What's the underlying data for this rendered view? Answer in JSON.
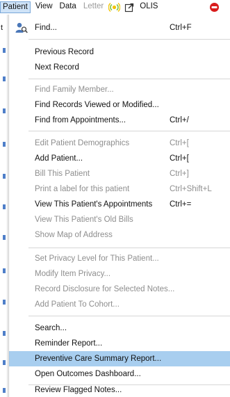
{
  "menubar": {
    "items": [
      "Patient",
      "View",
      "Data",
      "Letter",
      "OLIS"
    ]
  },
  "left_strip": {
    "char": "t"
  },
  "menu": {
    "find": {
      "label": "Find...",
      "accel": "Ctrl+F"
    },
    "previous_record": {
      "label": "Previous Record"
    },
    "next_record": {
      "label": "Next Record"
    },
    "find_family_member": {
      "label": "Find Family Member..."
    },
    "find_records_viewed": {
      "label": "Find Records Viewed or Modified..."
    },
    "find_from_appointments": {
      "label": "Find from Appointments...",
      "accel": "Ctrl+/"
    },
    "edit_patient_demographics": {
      "label": "Edit Patient Demographics",
      "accel": "Ctrl+["
    },
    "add_patient": {
      "label": "Add Patient...",
      "accel": "Ctrl+["
    },
    "bill_this_patient": {
      "label": "Bill This Patient",
      "accel": "Ctrl+]"
    },
    "print_label": {
      "label": "Print a label for this patient",
      "accel": "Ctrl+Shift+L"
    },
    "view_appointments": {
      "label": "View This Patient's Appointments",
      "accel": "Ctrl+="
    },
    "view_old_bills": {
      "label": "View This Patient's Old Bills"
    },
    "show_map": {
      "label": "Show Map of Address"
    },
    "set_privacy_level": {
      "label": "Set Privacy Level for This Patient..."
    },
    "modify_item_privacy": {
      "label": "Modify Item Privacy..."
    },
    "record_disclosure": {
      "label": "Record Disclosure for Selected Notes..."
    },
    "add_to_cohort": {
      "label": "Add Patient To Cohort..."
    },
    "search": {
      "label": "Search..."
    },
    "reminder_report": {
      "label": "Reminder Report..."
    },
    "preventive_care_report": {
      "label": "Preventive Care Summary Report..."
    },
    "outcomes_dashboard": {
      "label": "Open Outcomes Dashboard..."
    },
    "review_flagged_notes": {
      "label": "Review Flagged Notes..."
    }
  },
  "colors": {
    "highlight": "#a8ceef",
    "menubar_selected": "#cfe3f7",
    "disabled_text": "#8e8e8e",
    "alert_red": "#d91c1c"
  },
  "icons": {
    "find": "find-patient-icon",
    "menubar_alert": "alert-icon",
    "menubar_signal": "signal-icon",
    "menubar_external": "external-link-icon"
  }
}
